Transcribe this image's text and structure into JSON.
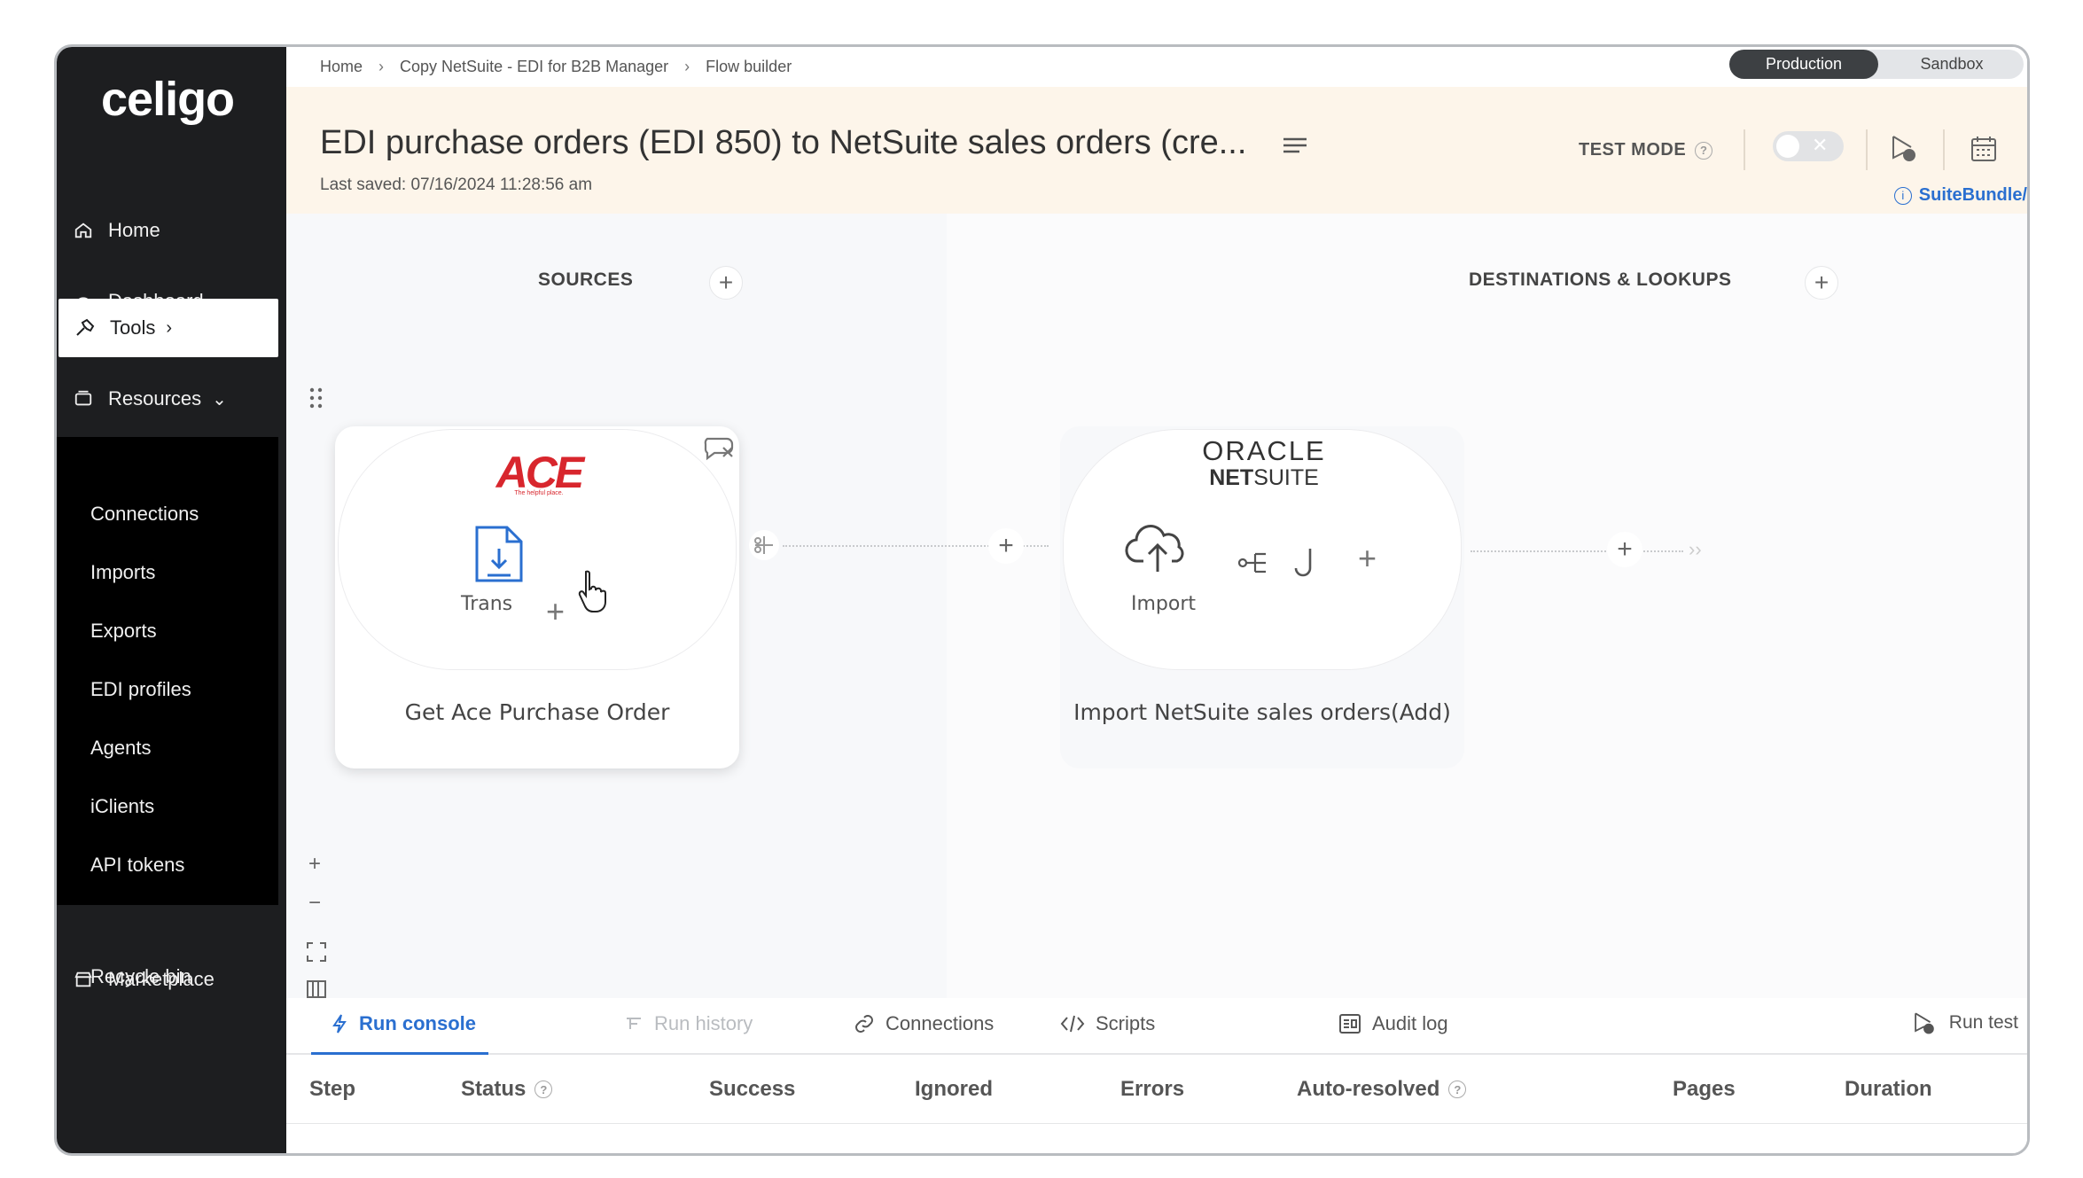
{
  "sidebar": {
    "logo": "celigo",
    "items": [
      {
        "label": "Home",
        "icon": "home-icon"
      },
      {
        "label": "Dashboard",
        "icon": "dashboard-icon"
      },
      {
        "label": "Tools",
        "icon": "tools-icon"
      },
      {
        "label": "Resources",
        "icon": "resources-icon"
      },
      {
        "label": "Marketplace",
        "icon": "marketplace-icon"
      }
    ],
    "sub_items": [
      "Connections",
      "Imports",
      "Exports",
      "EDI profiles",
      "Agents",
      "iClients",
      "API tokens",
      "Recycle bin"
    ]
  },
  "breadcrumb": [
    "Home",
    "Copy NetSuite - EDI for B2B Manager",
    "Flow builder"
  ],
  "environment": {
    "active": "Production",
    "inactive": "Sandbox"
  },
  "header": {
    "title": "EDI purchase orders (EDI 850) to NetSuite sales orders (cre...",
    "last_saved": "Last saved: 07/16/2024 11:28:56 am",
    "test_mode_label": "TEST MODE",
    "suitebundle_link": "SuiteBundle/"
  },
  "canvas": {
    "sources_label": "SOURCES",
    "destinations_label": "DESTINATIONS & LOOKUPS",
    "source_node": {
      "logo_text": "ACE",
      "logo_tagline": "The helpful place.",
      "step_label": "Trans",
      "title": "Get Ace Purchase Order"
    },
    "destination_node": {
      "logo_line1": "ORACLE",
      "logo_line2_bold": "NET",
      "logo_line2": "SUITE",
      "step_label": "Import",
      "title": "Import NetSuite sales orders(Add)"
    }
  },
  "console": {
    "tabs": [
      {
        "label": "Run console",
        "icon": "bolt-icon",
        "state": "active"
      },
      {
        "label": "Run history",
        "icon": "history-icon",
        "state": "disabled"
      },
      {
        "label": "Connections",
        "icon": "link-icon",
        "state": "normal"
      },
      {
        "label": "Scripts",
        "icon": "code-icon",
        "state": "normal"
      },
      {
        "label": "Audit log",
        "icon": "audit-log-icon",
        "state": "normal"
      }
    ],
    "run_test_label": "Run test",
    "columns": [
      "Step",
      "Status",
      "Success",
      "Ignored",
      "Errors",
      "Auto-resolved",
      "Pages",
      "Duration"
    ]
  },
  "colors": {
    "accent": "#2a6fd0",
    "sidebar_bg": "#1d1e20",
    "header_bg": "#fdf5ea",
    "ace_red": "#d8262d"
  }
}
